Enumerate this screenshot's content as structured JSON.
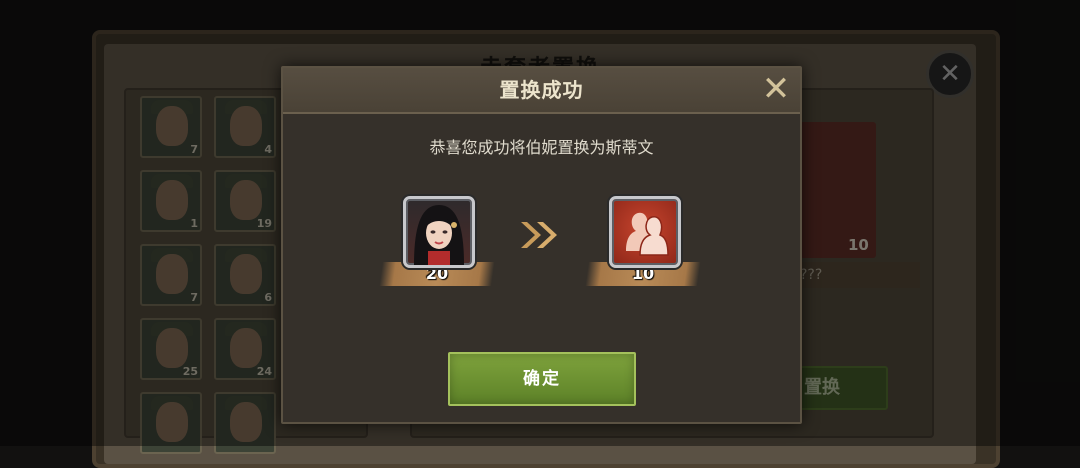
{
  "background_window": {
    "title": "赤套者置换",
    "cards": [
      {
        "count": "7"
      },
      {
        "count": "4"
      },
      {
        "count": "1"
      },
      {
        "count": "19"
      },
      {
        "count": "7"
      },
      {
        "count": "6"
      },
      {
        "count": "25"
      },
      {
        "count": "24"
      },
      {
        "count": ""
      },
      {
        "count": ""
      }
    ],
    "right_card_count": "10",
    "right_card_name": "???",
    "swap_button_label": "置换",
    "close_icon": "close-icon"
  },
  "dialog": {
    "title": "置换成功",
    "close_icon": "close-x-icon",
    "message": "恭喜您成功将伯妮置换为斯蒂文",
    "from_hero": {
      "count": "20",
      "icon": "hero-portrait-icon"
    },
    "to_hero": {
      "count": "10",
      "icon": "hero-silhouette-icon"
    },
    "arrow_icon": "double-chevron-right-icon",
    "confirm_label": "确定"
  },
  "colors": {
    "confirm_green": "#6e922f",
    "title_gold": "#ece4cc",
    "ribbon_brown": "#b88a57",
    "silhouette_red": "#c8452e"
  }
}
